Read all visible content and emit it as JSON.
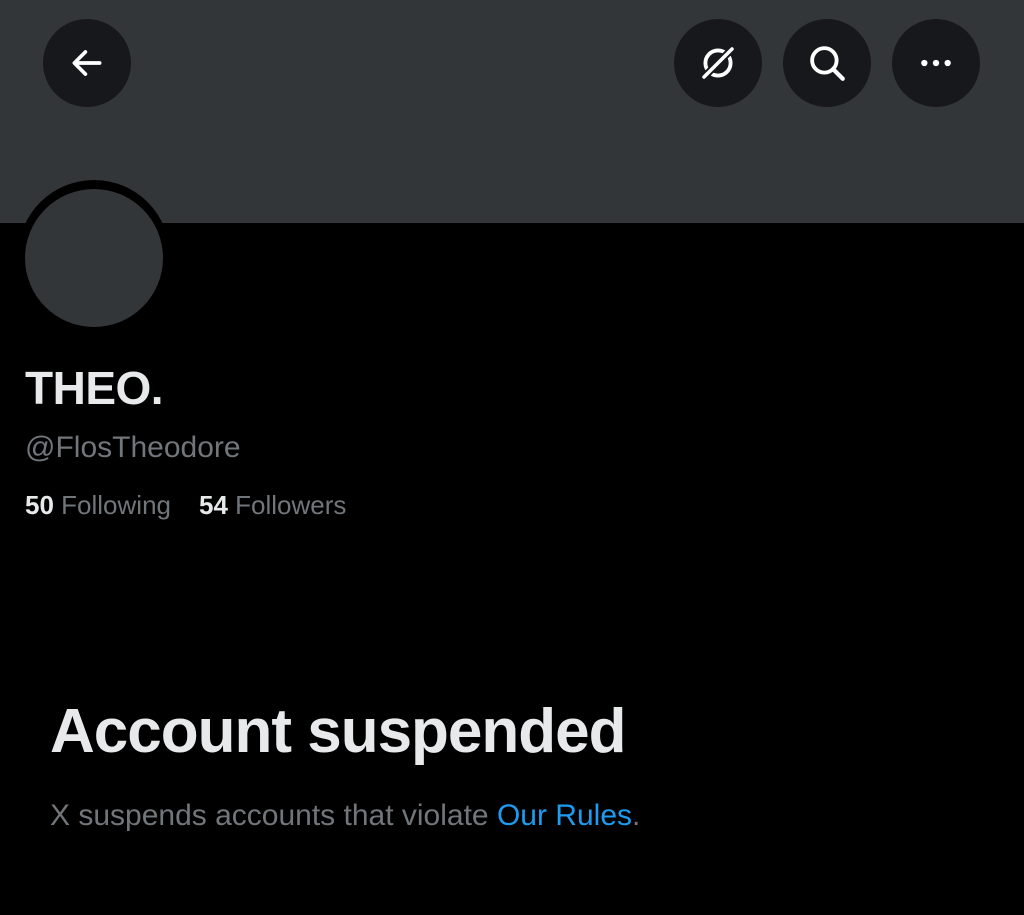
{
  "header": {
    "icons": {
      "back": "arrow-left-icon",
      "grok": "grok-icon",
      "search": "search-icon",
      "more": "more-horizontal-icon"
    }
  },
  "profile": {
    "display_name": "THEO.",
    "handle": "@FlosTheodore",
    "following_count": "50",
    "following_label": "Following",
    "followers_count": "54",
    "followers_label": "Followers"
  },
  "suspension": {
    "title": "Account suspended",
    "message_prefix": "X suspends accounts that violate ",
    "rules_link": "Our Rules",
    "message_suffix": "."
  },
  "colors": {
    "background": "#000000",
    "banner": "#333639",
    "button_bg": "#16181c",
    "text_primary": "#e7e9ea",
    "text_secondary": "#71767b",
    "link": "#1d9bf0"
  }
}
